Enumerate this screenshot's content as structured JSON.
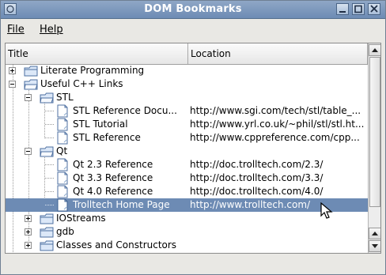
{
  "window": {
    "title": "DOM Bookmarks"
  },
  "menu": [
    "File",
    "Help"
  ],
  "columns": {
    "title": "Title",
    "location": "Location"
  },
  "rows": [
    {
      "title": "Literate Programming",
      "location": "",
      "type": "folder",
      "expander": "plus"
    },
    {
      "title": "Useful C++ Links",
      "location": "",
      "type": "folder",
      "expander": "minus"
    },
    {
      "title": "STL",
      "location": "",
      "type": "folder",
      "expander": "minus"
    },
    {
      "title": "STL Reference Docu...",
      "location": "http://www.sgi.com/tech/stl/table_...",
      "type": "bookmark"
    },
    {
      "title": "STL Tutorial",
      "location": "http://www.yrl.co.uk/~phil/stl/stl.ht...",
      "type": "bookmark"
    },
    {
      "title": "STL Reference",
      "location": "http://www.cppreference.com/cpp...",
      "type": "bookmark"
    },
    {
      "title": "Qt",
      "location": "",
      "type": "folder",
      "expander": "minus"
    },
    {
      "title": "Qt 2.3 Reference",
      "location": "http://doc.trolltech.com/2.3/",
      "type": "bookmark"
    },
    {
      "title": "Qt 3.3 Reference",
      "location": "http://doc.trolltech.com/3.3/",
      "type": "bookmark"
    },
    {
      "title": "Qt 4.0 Reference",
      "location": "http://doc.trolltech.com/4.0/",
      "type": "bookmark"
    },
    {
      "title": "Trolltech Home Page",
      "location": "http://www.trolltech.com/",
      "type": "bookmark",
      "selected": true
    },
    {
      "title": "IOStreams",
      "location": "",
      "type": "folder",
      "expander": "plus"
    },
    {
      "title": "gdb",
      "location": "",
      "type": "folder",
      "expander": "plus"
    },
    {
      "title": "Classes and Constructors",
      "location": "",
      "type": "folder",
      "expander": "plus"
    }
  ],
  "colors": {
    "selection": "#6d8bb4",
    "titlebar": "#7a96bd"
  }
}
